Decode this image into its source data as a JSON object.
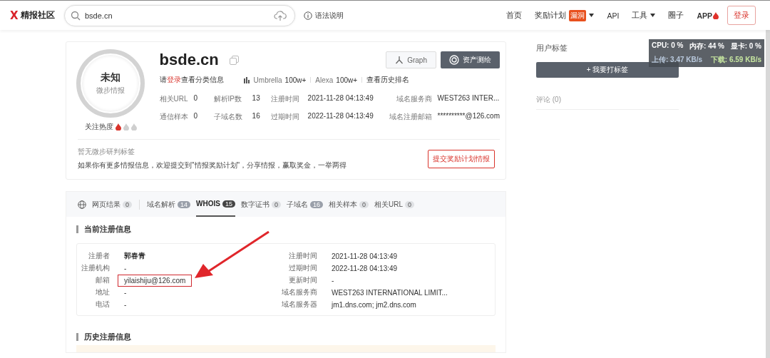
{
  "header": {
    "logo_mark": "X",
    "logo_text": "精报社区",
    "search": {
      "value": "bsde.cn"
    },
    "syntax_help": "语法说明",
    "nav": [
      {
        "label": "首页",
        "dropdown": false
      },
      {
        "label": "奖励计划",
        "badge": "漏洞",
        "dropdown": true
      },
      {
        "label": "API",
        "dropdown": false
      },
      {
        "label": "工具",
        "dropdown": true
      },
      {
        "label": "圈子",
        "dropdown": false
      }
    ],
    "app": "APP",
    "login": "登录"
  },
  "domain_card": {
    "verdict": "未知",
    "verdict_source": "微步情报",
    "heat_label": "关注热度",
    "heat": {
      "stars": 1
    },
    "domain": "bsde.cn",
    "graph_button": "Graph",
    "mapping_button": "资产测绘",
    "login_hint": "请**登录**查看分类信息",
    "umbrella_label": "Umbrella",
    "umbrella_value": "100w+",
    "alexa_label": "Alexa",
    "alexa_value": "100w+",
    "rank_history": "查看历史排名",
    "stats": [
      {
        "label": "相关URL",
        "value": "0"
      },
      {
        "label": "解析IP数",
        "value": "13"
      },
      {
        "label": "注册时间",
        "value": "2021-11-28 04:13:49"
      },
      {
        "label": "域名服务商",
        "value": "WEST263 INTER..."
      },
      {
        "label": "通信样本",
        "value": "0"
      },
      {
        "label": "子域名数",
        "value": "16"
      },
      {
        "label": "过期时间",
        "value": "2022-11-28 04:13:49"
      },
      {
        "label": "域名注册邮箱",
        "value": "**********@126.com"
      }
    ],
    "no_tags": "暂无微步研判标签",
    "invite": "如果你有更多情报信息，欢迎提交到\"情报奖励计划\"，分享情报，赢取奖金，一举两得",
    "submit_button": "提交奖励计划情报"
  },
  "tabs": [
    {
      "label": "网页结果",
      "count": "0",
      "selected": false
    },
    {
      "label": "域名解析",
      "count": "14",
      "selected": false
    },
    {
      "label": "WHOIS",
      "count": "15",
      "selected": true
    },
    {
      "label": "数字证书",
      "count": "0",
      "selected": false
    },
    {
      "label": "子域名",
      "count": "16",
      "selected": false
    },
    {
      "label": "相关样本",
      "count": "0",
      "selected": false
    },
    {
      "label": "相关URL",
      "count": "0",
      "selected": false
    }
  ],
  "whois": {
    "title": "当前注册信息",
    "left": [
      {
        "label": "注册者",
        "value": "郭春青",
        "highlighted": false
      },
      {
        "label": "注册机构",
        "value": "-",
        "highlighted": false
      },
      {
        "label": "邮箱",
        "value": "yilaishiju@126.com",
        "highlighted": true
      },
      {
        "label": "地址",
        "value": "-",
        "highlighted": false
      },
      {
        "label": "电话",
        "value": "-",
        "highlighted": false
      }
    ],
    "right": [
      {
        "label": "注册时间",
        "value": "2021-11-28 04:13:49"
      },
      {
        "label": "过期时间",
        "value": "2022-11-28 04:13:49"
      },
      {
        "label": "更新时间",
        "value": "-"
      },
      {
        "label": "域名服务商",
        "value": "WEST263 INTERNATIONAL LIMIT..."
      },
      {
        "label": "域名服务器",
        "value": "jm1.dns.com; jm2.dns.com"
      }
    ],
    "history_title": "历史注册信息"
  },
  "sidebar": {
    "tags_title": "用户标签",
    "add_tag_button": "+ 我要打标签",
    "comments": "评论 (0)"
  },
  "monitor": {
    "cpu": "CPU: 0 %",
    "memory": "内存: 44 %",
    "gpu": "显卡: 0 %",
    "upload": "上传: 3.47 KB/s",
    "download": "下载: 6.59 KB/s"
  }
}
